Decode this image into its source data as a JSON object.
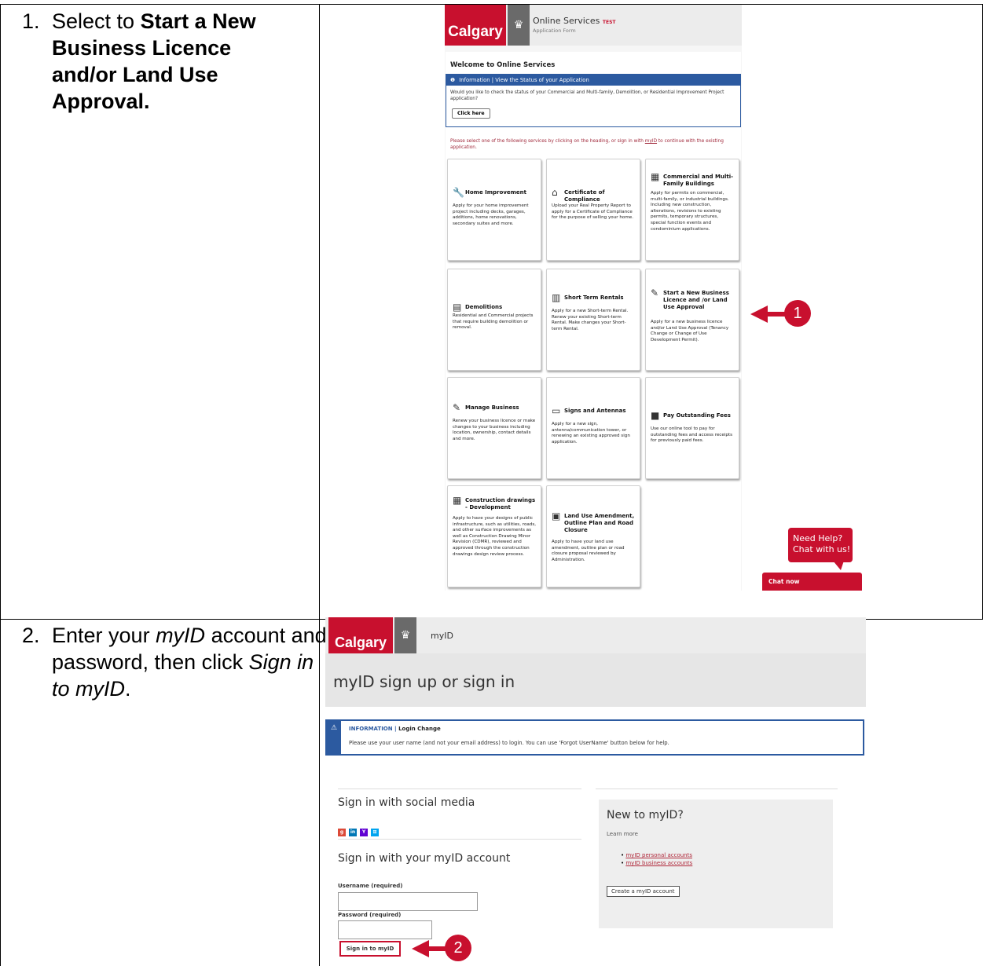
{
  "steps": [
    {
      "number": "1.",
      "parts": [
        {
          "t": "Select to ",
          "s": "n"
        },
        {
          "t": "Start a New Business Licence and/or Land Use Approval.",
          "s": "b"
        }
      ]
    },
    {
      "number": "2.",
      "parts": [
        {
          "t": "Enter your ",
          "s": "n"
        },
        {
          "t": "myID",
          "s": "i"
        },
        {
          "t": " account and password, then click ",
          "s": "n"
        },
        {
          "t": "Sign in to myID",
          "s": "i"
        },
        {
          "t": ".",
          "s": "n"
        }
      ]
    }
  ],
  "colors": {
    "brand_red": "#c8102e",
    "info_blue": "#2c5aa0"
  },
  "online_services": {
    "logo": "Calgary",
    "title": "Online Services",
    "test_badge": "TEST",
    "subtitle": "Application Form",
    "welcome": "Welcome to Online Services",
    "info_header": "Information | View the Status of your Application",
    "info_text": "Would you like to check the status of your Commercial and Multi-family, Demolition, or Residential Improvement Project application?",
    "click_here": "Click here",
    "instruction_pre": "Please select one of the following services by clicking on the heading, or sign in with ",
    "instruction_link": "myID",
    "instruction_post": " to continue with the existing application.",
    "cards": [
      {
        "icon": "wrench-icon",
        "glyph": "🔧",
        "title": "Home Improvement",
        "desc": "Apply for your home improvement project including decks, garages, additions, home renovations, secondary suites and more."
      },
      {
        "icon": "house-icon",
        "glyph": "⌂",
        "title": "Certificate of Compliance",
        "desc": "Upload your Real Property Report to apply for a Certificate of Compliance for the purpose of selling your home."
      },
      {
        "icon": "building-icon",
        "glyph": "▦",
        "title": "Commercial and Multi-Family Buildings",
        "desc": "Apply for permits on commercial, multi-family, or industrial buildings. Including new construction, alterations, revisions to existing permits, temporary structures, special function events and condominium applications."
      },
      {
        "icon": "demolition-icon",
        "glyph": "▤",
        "title": "Demolitions",
        "desc": "Residential and Commercial projects that require building demolition or removal."
      },
      {
        "icon": "rental-icon",
        "glyph": "▥",
        "title": "Short Term Rentals",
        "desc": "Apply for a new Short-term Rental. Renew your existing Short-term Rental. Make changes your Short-term Rental."
      },
      {
        "icon": "licence-icon",
        "glyph": "✎",
        "title": "Start a New Business Licence and /or Land Use Approval",
        "desc": "Apply for a new business licence and/or Land Use Approval (Tenancy Change or Change of Use Development Permit)."
      },
      {
        "icon": "edit-icon",
        "glyph": "✎",
        "title": "Manage Business",
        "desc": "Renew your business licence or make changes to your business including location, ownership, contact details and more."
      },
      {
        "icon": "sign-icon",
        "glyph": "▭",
        "title": "Signs and Antennas",
        "desc": "Apply for a new sign, antenna/communication tower, or renewing an existing approved sign application."
      },
      {
        "icon": "briefcase-icon",
        "glyph": "■",
        "title": "Pay Outstanding Fees",
        "desc": "Use our online tool to pay for outstanding fees and access receipts for previously paid fees."
      },
      {
        "icon": "drawing-icon",
        "glyph": "▦",
        "title": "Construction drawings - Development",
        "desc": "Apply to have your designs of public infrastructure, such as utilities, roads, and other surface improvements as well as Construction Drawing Minor Revision (CDMR), reviewed and approved through the construction drawings design review process."
      },
      {
        "icon": "land-use-icon",
        "glyph": "▣",
        "title": "Land Use Amendment, Outline Plan and Road Closure",
        "desc": "Apply to have your land use amendment, outline plan or road closure proposal reviewed by Administration."
      }
    ],
    "help_bubble": [
      "Need Help?",
      "Chat with us!"
    ],
    "chat_now": "Chat now",
    "callout": "1"
  },
  "myid": {
    "logo": "Calgary",
    "app_name": "myID",
    "heading": "myID sign up or sign in",
    "info_label": "INFORMATION",
    "info_sep": " | ",
    "info_title": "Login Change",
    "info_text": "Please use your user name (and not your email address) to login. You can use 'Forgot UserName' button below for help.",
    "social_heading": "Sign in with social media",
    "social_icons": [
      {
        "name": "google-icon",
        "glyph": "g",
        "color": "#dc4a38"
      },
      {
        "name": "linkedin-icon",
        "glyph": "in",
        "color": "#0077b5"
      },
      {
        "name": "yahoo-icon",
        "glyph": "Y",
        "color": "#6001d2"
      },
      {
        "name": "microsoft-icon",
        "glyph": "⊞",
        "color": "#00a4ef"
      }
    ],
    "account_heading": "Sign in with your myID account",
    "username_label": "Username (required)",
    "password_label": "Password (required)",
    "sign_in_button": "Sign in to myID",
    "new_heading": "New to myID?",
    "learn_more": "Learn more",
    "links": [
      "myID personal accounts",
      "myID business accounts"
    ],
    "create_button": "Create a myID account",
    "callout": "2"
  }
}
